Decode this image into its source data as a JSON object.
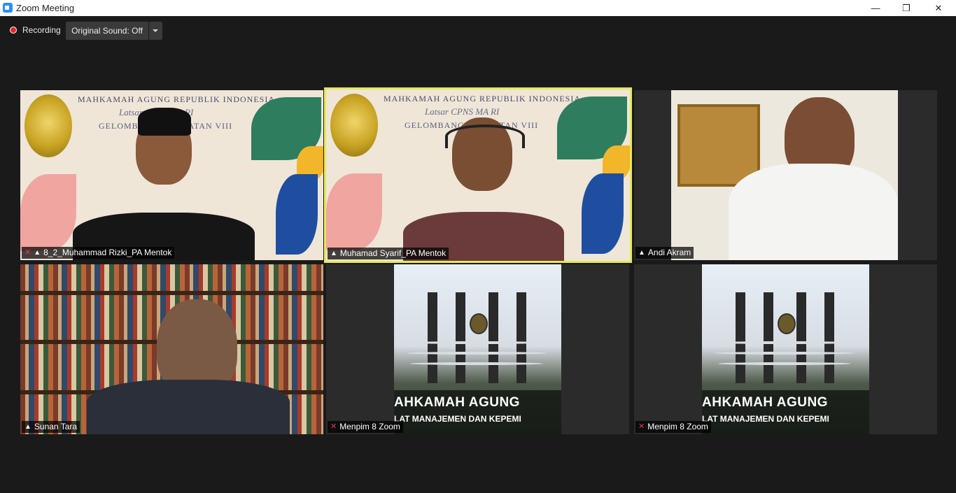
{
  "window": {
    "title": "Zoom Meeting",
    "minimize": "—",
    "restore": "❐",
    "close": "✕"
  },
  "toolbar": {
    "recording_label": "Recording",
    "original_sound": "Original Sound: Off"
  },
  "colors": {
    "active_speaker": "#e4e95a",
    "mute": "#e23b3b",
    "recording": "#e02828"
  },
  "participants": [
    {
      "name": "8_2_Muhammad Rizki_PA Mentok",
      "muted": true,
      "pinned_icon": true
    },
    {
      "name": "Muhamad Syarif_PA Mentok",
      "muted": false,
      "pinned_icon": true,
      "active": true
    },
    {
      "name": "Andi Akram",
      "muted": false,
      "pinned_icon": true
    },
    {
      "name": "Sunan Tara",
      "muted": false,
      "pinned_icon": true
    },
    {
      "name": "Menpim 8 Zoom",
      "muted": true,
      "pinned_icon": false
    },
    {
      "name": "Menpim 8 Zoom",
      "muted": true,
      "pinned_icon": false
    }
  ],
  "backgrounds": {
    "banner_title": "MAHKAMAH AGUNG REPUBLIK INDONESIA",
    "banner_sub": "Latsar CPNS MA RI",
    "banner_sub2": "GELOMBANG ANGKATAN VIII",
    "sign_line1": "AHKAMAH AGUNG",
    "sign_line2": "LAT MANAJEMEN DAN KEPEMI"
  }
}
